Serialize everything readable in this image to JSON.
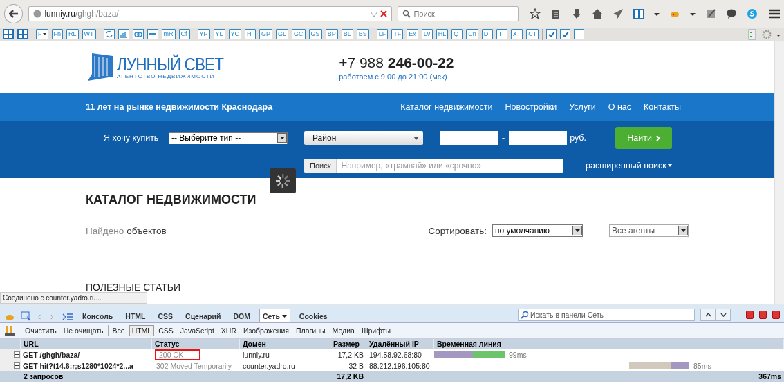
{
  "browser": {
    "url_host": "lunniy.ru",
    "url_path": "/ghgh/baza/",
    "search_placeholder": "Поиск"
  },
  "seo_toolbar": {
    "items": [
      {
        "kind": "sape"
      },
      {
        "kind": "sape"
      },
      {
        "kind": "sep"
      },
      {
        "kind": "text",
        "label": "F",
        "dropdown": true
      },
      {
        "kind": "text",
        "label": "Fn"
      },
      {
        "kind": "text",
        "label": "RL"
      },
      {
        "kind": "text",
        "label": "WT"
      },
      {
        "kind": "sep"
      },
      {
        "kind": "sync"
      },
      {
        "kind": "chart"
      },
      {
        "kind": "rings"
      },
      {
        "kind": "dash"
      },
      {
        "kind": "text",
        "label": "mR"
      },
      {
        "kind": "text",
        "label": "Cf"
      },
      {
        "kind": "sep"
      },
      {
        "kind": "text",
        "label": "YP"
      },
      {
        "kind": "text",
        "label": "YL"
      },
      {
        "kind": "text",
        "label": "YC"
      },
      {
        "kind": "text",
        "label": "H"
      },
      {
        "kind": "text",
        "label": "GP"
      },
      {
        "kind": "text",
        "label": "GL"
      },
      {
        "kind": "text",
        "label": "GC"
      },
      {
        "kind": "text",
        "label": "GS"
      },
      {
        "kind": "text",
        "label": "BP"
      },
      {
        "kind": "text",
        "label": "BL"
      },
      {
        "kind": "text",
        "label": "BS"
      },
      {
        "kind": "sep"
      },
      {
        "kind": "text",
        "label": "LF"
      },
      {
        "kind": "text",
        "label": "TF"
      },
      {
        "kind": "text",
        "label": "Ex"
      },
      {
        "kind": "text",
        "label": "Lv"
      },
      {
        "kind": "text",
        "label": "HL"
      },
      {
        "kind": "text",
        "label": "Q"
      },
      {
        "kind": "text",
        "label": "Cn"
      },
      {
        "kind": "text",
        "label": "D"
      },
      {
        "kind": "text",
        "label": "T"
      },
      {
        "kind": "text",
        "label": "XT"
      },
      {
        "kind": "text",
        "label": "CT"
      },
      {
        "kind": "sep"
      },
      {
        "kind": "check",
        "checked": true
      },
      {
        "kind": "check",
        "checked": true
      },
      {
        "kind": "check",
        "checked": false
      }
    ]
  },
  "site": {
    "logo": {
      "title": "ЛУННЫЙ СВЕТ",
      "subtitle": "АГЕНТСТВО НЕДВИЖИМОСТИ"
    },
    "phone": {
      "prefix": "+7 988",
      "number": "246-00-22",
      "hours": "работаем с 9:00 до 21:00 (мск)"
    },
    "nav": {
      "tagline": "11 лет на рынке недвижимости Краснодара",
      "links": [
        "Каталог недвижимости",
        "Новостройки",
        "Услуги",
        "О нас",
        "Контакты"
      ]
    },
    "search": {
      "label": "Я хочу купить",
      "type_select": "-- Выберите тип --",
      "district_select": "Район",
      "price_separator": "-",
      "currency": "руб.",
      "submit": "Найти",
      "query_button": "Поиск",
      "query_placeholder": "Например, «трамвай» или «срочно»",
      "advanced": "расширенный поиск"
    },
    "catalog": {
      "heading": "КАТАЛОГ НЕДВИЖИМОСТИ",
      "found_label": "Найдено",
      "found_unit": "объектов",
      "sort_label": "Сортировать:",
      "sort_select": "по умолчанию",
      "agents_select": "Все агенты",
      "articles_heading": "ПОЛЕЗНЫЕ СТАТЬИ"
    },
    "status_text": "Соединено с counter.yadro.ru..."
  },
  "devtools": {
    "tabs": [
      {
        "label": "Консоль",
        "selected": false
      },
      {
        "label": "HTML",
        "selected": false
      },
      {
        "label": "CSS",
        "selected": false
      },
      {
        "label": "Сценарий",
        "selected": false
      },
      {
        "label": "DOM",
        "selected": false
      },
      {
        "label": "Сеть",
        "selected": true
      },
      {
        "label": "Cookies",
        "selected": false
      }
    ],
    "search_placeholder": "Искать в панели Сеть",
    "actions": [
      "Очистить",
      "Не очищать"
    ],
    "filters": [
      {
        "label": "Все",
        "selected": false
      },
      {
        "label": "HTML",
        "selected": true
      },
      {
        "label": "CSS",
        "selected": false
      },
      {
        "label": "JavaScript",
        "selected": false
      },
      {
        "label": "XHR",
        "selected": false
      },
      {
        "label": "Изображения",
        "selected": false
      },
      {
        "label": "Плагины",
        "selected": false
      },
      {
        "label": "Медиа",
        "selected": false
      },
      {
        "label": "Шрифты",
        "selected": false
      }
    ],
    "columns": [
      "URL",
      "Статус",
      "Домен",
      "Размер",
      "Удалённый IP",
      "Временная линия"
    ],
    "rows": [
      {
        "url": "GET /ghgh/baza/",
        "status": "200 OK",
        "highlighted": true,
        "domain": "lunniy.ru",
        "size": "17,2 KB",
        "ip": "194.58.92.68:80",
        "time": "99ms"
      },
      {
        "url": "GET hit?t14.6;r;s1280*1024*2...a",
        "status": "302 Moved Temporarily",
        "highlighted": false,
        "domain": "counter.yadro.ru",
        "size": "32 B",
        "ip": "88.212.196.105:80",
        "time": "85ms"
      }
    ],
    "footer": {
      "count": "2 запросов",
      "size": "17,2 KB",
      "time": "367ms"
    }
  }
}
